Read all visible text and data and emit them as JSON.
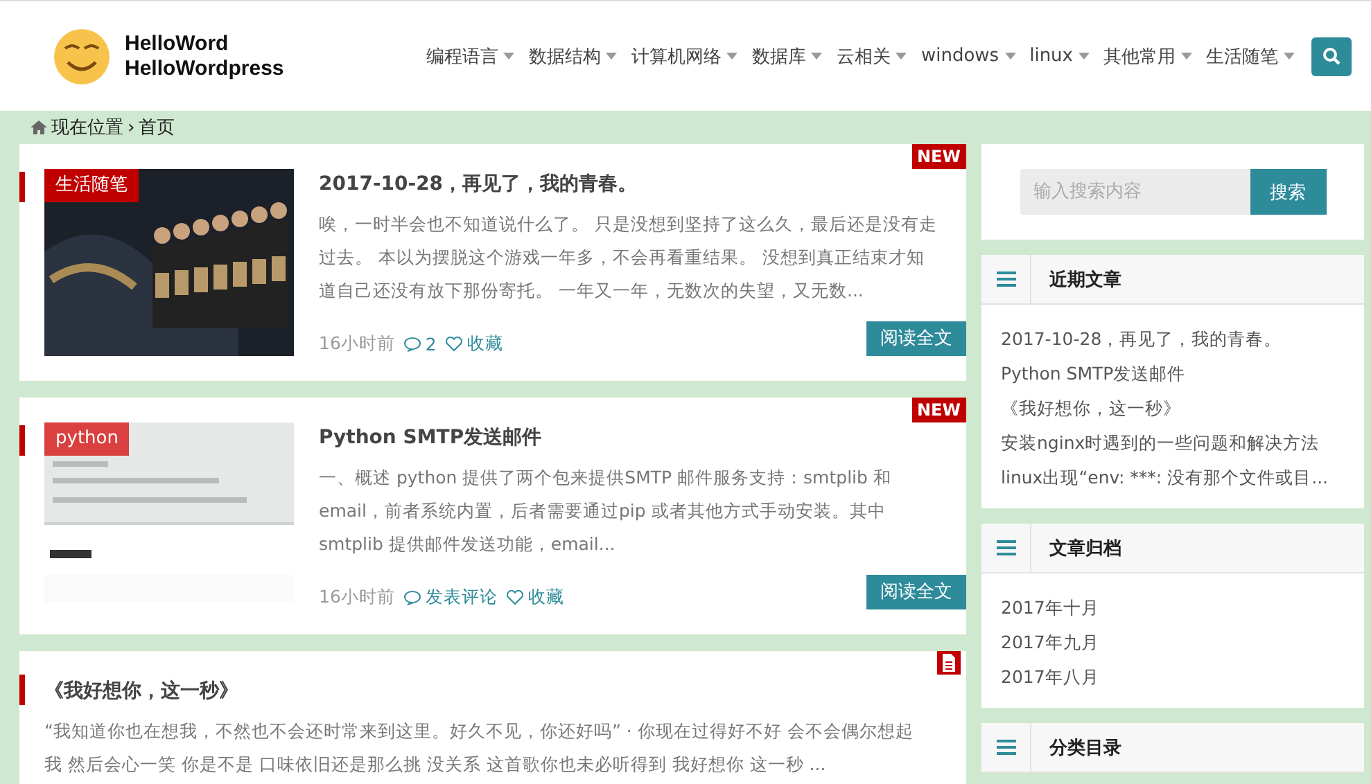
{
  "site": {
    "title_lines": [
      "HelloWord",
      "HelloWordpress"
    ]
  },
  "nav": {
    "items": [
      {
        "label": "编程语言"
      },
      {
        "label": "数据结构"
      },
      {
        "label": "计算机网络"
      },
      {
        "label": "数据库"
      },
      {
        "label": "云相关"
      },
      {
        "label": "windows"
      },
      {
        "label": "linux"
      },
      {
        "label": "其他常用"
      },
      {
        "label": "生活随笔"
      }
    ]
  },
  "breadcrumb": {
    "items": [
      "现在位置",
      "首页"
    ],
    "separator": "›"
  },
  "posts": [
    {
      "kind": "thumb",
      "badge": {
        "kind": "new",
        "text": "NEW"
      },
      "category": "生活随笔",
      "color": "#c00000",
      "title": "2017-10-28，再见了，我的青春。",
      "excerpt": "唉，一时半会也不知道说什么了。 只是没想到坚持了这么久，最后还是没有走过去。 本以为摆脱这个游戏一年多，不会再看重结果。 没想到真正结束才知道自己还没有放下那份寄托。 一年又一年，无数次的失望，又无数...",
      "time": "16小时前",
      "comments": "2",
      "favorite": "收藏",
      "read": "阅读全文"
    },
    {
      "kind": "thumb",
      "badge": {
        "kind": "new",
        "text": "NEW"
      },
      "category": "python",
      "color": "#d9403f",
      "title": "Python SMTP发送邮件",
      "excerpt": "一、概述 python 提供了两个包来提供SMTP 邮件服务支持：smtplib 和 email，前者系统内置，后者需要通过pip 或者其他方式手动安装。其中smtplib 提供邮件发送功能，email...",
      "time": "16小时前",
      "comments": "发表评论",
      "favorite": "收藏",
      "read": "阅读全文"
    },
    {
      "kind": "text",
      "badge": {
        "kind": "doc"
      },
      "title": "《我好想你，这一秒》",
      "excerpt": "“我知道你也在想我，不然也不会还时常来到这里。好久不见，你还好吗” · 你现在过得好不好 会不会偶尔想起我 然后会心一笑 你是不是 口味依旧还是那么挑 没关系 这首歌你也未必听得到 我好想你 这一秒 ..."
    }
  ],
  "sidebar": {
    "search": {
      "placeholder": "输入搜索内容",
      "button": "搜索"
    },
    "widgets": [
      {
        "title": "近期文章",
        "items": [
          "2017-10-28，再见了，我的青春。",
          "Python SMTP发送邮件",
          "《我好想你，这一秒》",
          "安装nginx时遇到的一些问题和解决方法",
          "linux出现“env: ***: 没有那个文件或目..."
        ]
      },
      {
        "title": "文章归档",
        "items": [
          "2017年十月",
          "2017年九月",
          "2017年八月"
        ]
      },
      {
        "title": "分类目录"
      }
    ]
  }
}
